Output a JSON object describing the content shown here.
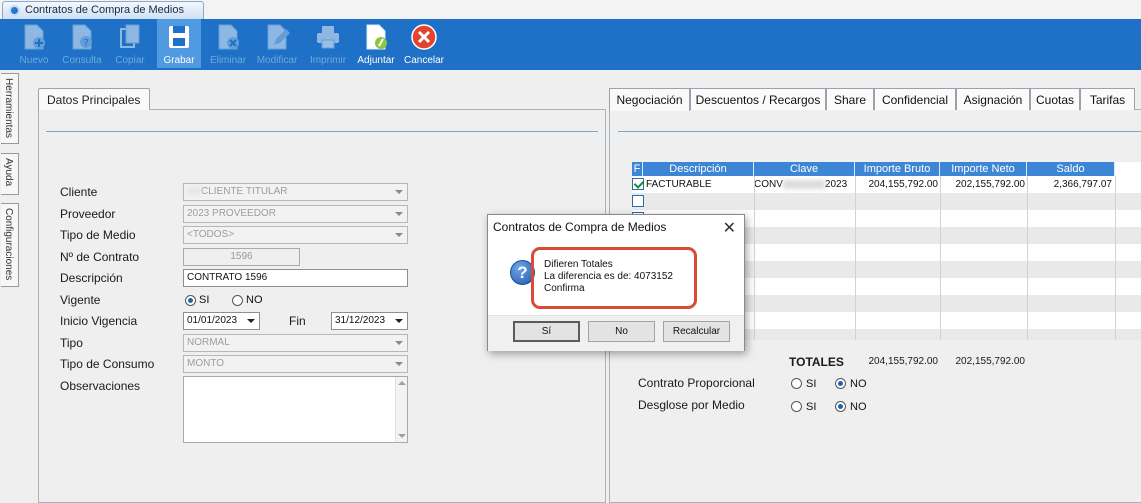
{
  "window": {
    "tab_title": "Contratos de Compra de Medios"
  },
  "toolbar": {
    "nuevo": "Nuevo",
    "consulta": "Consulta",
    "copiar": "Copiar",
    "grabar": "Grabar",
    "eliminar": "Eliminar",
    "modificar": "Modificar",
    "imprimir": "Imprimir",
    "adjuntar": "Adjuntar",
    "cancelar": "Cancelar"
  },
  "side_tabs": {
    "herramientas": "Herramientas",
    "ayuda": "Ayuda",
    "configuraciones": "Configuraciones"
  },
  "left_panel": {
    "tab": "Datos Principales",
    "labels": {
      "cliente": "Cliente",
      "proveedor": "Proveedor",
      "tipo_medio": "Tipo de Medio",
      "nro_contrato": "Nº de Contrato",
      "descripcion": "Descripción",
      "vigente": "Vigente",
      "inicio_vigencia": "Inicio Vigencia",
      "fin": "Fin",
      "tipo": "Tipo",
      "tipo_consumo": "Tipo de Consumo",
      "observaciones": "Observaciones"
    },
    "values": {
      "cliente": "CLIENTE TITULAR",
      "proveedor": "2023 PROVEEDOR",
      "tipo_medio": "<TODOS>",
      "nro_contrato": "1596",
      "descripcion": "CONTRATO 1596",
      "vigente_si": "SI",
      "vigente_no": "NO",
      "inicio_vigencia": "01/01/2023",
      "fin": "31/12/2023",
      "tipo": "NORMAL",
      "tipo_consumo": "MONTO",
      "observaciones": ""
    }
  },
  "right_panel": {
    "tabs": [
      "Negociación",
      "Descuentos / Recargos",
      "Share",
      "Confidencial",
      "Asignación",
      "Cuotas",
      "Tarifas"
    ],
    "grid": {
      "columns": [
        "F",
        "Descripción",
        "Clave",
        "Importe Bruto",
        "Importe Neto",
        "Saldo"
      ],
      "row1": {
        "descripcion": "FACTURABLE",
        "clave_a": "CONV",
        "clave_b": "2023",
        "importe_bruto": "204,155,792.00",
        "importe_neto": "202,155,792.00",
        "saldo": "2,366,797.07"
      }
    },
    "totales": {
      "label": "TOTALES",
      "bruto": "204,155,792.00",
      "neto": "202,155,792.00"
    },
    "contrato_proporcional": {
      "label": "Contrato Proporcional",
      "si": "SI",
      "no": "NO"
    },
    "desglose_medio": {
      "label": "Desglose por Medio",
      "si": "SI",
      "no": "NO"
    }
  },
  "dialog": {
    "title": "Contratos de Compra de Medios",
    "close": "✕",
    "line1": "Difieren Totales",
    "line2": "La diferencia es de: 4073152",
    "line3": "Confirma",
    "btn_si": "Sí",
    "btn_no": "No",
    "btn_recalcular": "Recalcular"
  }
}
